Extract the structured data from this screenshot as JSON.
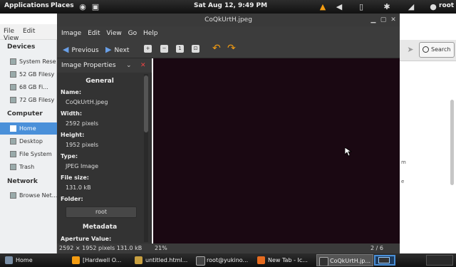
{
  "top_panel": {
    "applications": "Applications",
    "places": "Places",
    "clock": "Sat Aug 12,  9:49 PM",
    "user": "root"
  },
  "nautilus": {
    "menu": [
      "File",
      "Edit",
      "View"
    ],
    "sidebar": {
      "devices_header": "Devices",
      "devices": [
        "System Rese",
        "52 GB Filesy",
        "68 GB Fi...",
        "72 GB Filesy"
      ],
      "computer_header": "Computer",
      "computer": [
        "Home",
        "Desktop",
        "File System",
        "Trash"
      ],
      "network_header": "Network",
      "network": [
        "Browse Net..."
      ]
    },
    "search_label": "Search",
    "fragments": [
      "m",
      "e"
    ]
  },
  "eog": {
    "title": "CoQkUrtH.jpeg",
    "menu": [
      "Image",
      "Edit",
      "View",
      "Go",
      "Help"
    ],
    "toolbar": {
      "previous": "Previous",
      "next": "Next"
    },
    "sidebar": {
      "header": "Image Properties",
      "general": "General",
      "props": [
        {
          "label": "Name:",
          "value": "CoQkUrtH.jpeg"
        },
        {
          "label": "Width:",
          "value": "2592 pixels"
        },
        {
          "label": "Height:",
          "value": "1952 pixels"
        },
        {
          "label": "Type:",
          "value": "JPEG Image"
        },
        {
          "label": "File size:",
          "value": "131.0 kB"
        },
        {
          "label": "Folder:",
          "value": "root"
        }
      ],
      "metadata": "Metadata",
      "aperture_label": "Aperture Value:"
    },
    "status": {
      "dims_size": "2592 × 1952 pixels  131.0 kB",
      "zoom": "21%",
      "position": "2 / 6"
    },
    "colors": {
      "canvas": "#1a0812",
      "accent": "#4a90d9"
    }
  },
  "taskbar": {
    "tasks": [
      "Home",
      "[Hardwell O...",
      "untitled.html...",
      "root@yukino...",
      "New Tab - Ic...",
      "CoQkUrtH.jp..."
    ]
  }
}
